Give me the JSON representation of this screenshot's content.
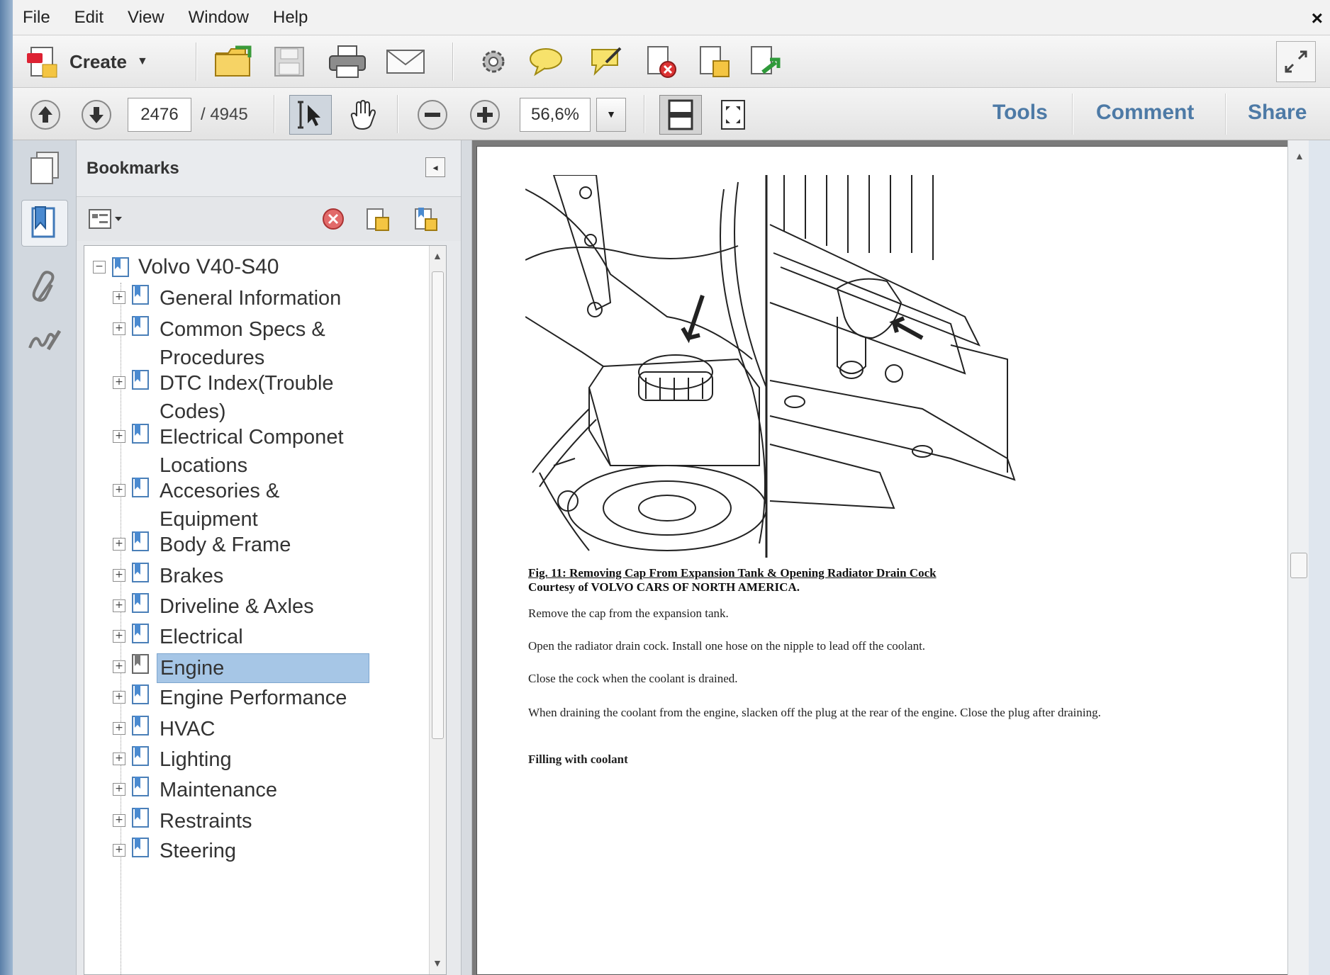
{
  "menu": [
    "File",
    "Edit",
    "View",
    "Window",
    "Help"
  ],
  "toolbar": {
    "create_label": "Create"
  },
  "nav_toolbar": {
    "current_page": "2476",
    "total_pages": "/ 4945",
    "zoom": "56,6%",
    "tools_label": "Tools",
    "comment_label": "Comment",
    "share_label": "Share"
  },
  "bookmarks": {
    "title": "Bookmarks",
    "root": "Volvo V40-S40",
    "items": [
      {
        "label": "General Information"
      },
      {
        "label": "Common Specs & Procedures"
      },
      {
        "label": "DTC Index(Trouble Codes)"
      },
      {
        "label": "Electrical Componet Locations"
      },
      {
        "label": "Accesories & Equipment"
      },
      {
        "label": "Body & Frame"
      },
      {
        "label": "Brakes"
      },
      {
        "label": "Driveline & Axles"
      },
      {
        "label": "Electrical"
      },
      {
        "label": "Engine",
        "selected": true
      },
      {
        "label": "Engine Performance"
      },
      {
        "label": "HVAC"
      },
      {
        "label": "Lighting"
      },
      {
        "label": "Maintenance"
      },
      {
        "label": "Restraints"
      },
      {
        "label": "Steering"
      }
    ]
  },
  "document": {
    "caption_title": "Fig. 11: Removing Cap From Expansion Tank & Opening Radiator Drain Cock",
    "caption_credit": "Courtesy of VOLVO CARS OF NORTH AMERICA.",
    "paragraphs": [
      "Remove the cap from the expansion tank.",
      "Open the radiator drain cock. Install one hose on the nipple to lead off the coolant.",
      "Close the cock when the coolant is drained.",
      "When draining the coolant from the engine, slacken off the plug at the rear of the engine. Close the plug after draining.",
      "Filling with coolant"
    ]
  },
  "colors": {
    "accent_link": "#4d7aa6",
    "selection": "#a6c6e6"
  }
}
